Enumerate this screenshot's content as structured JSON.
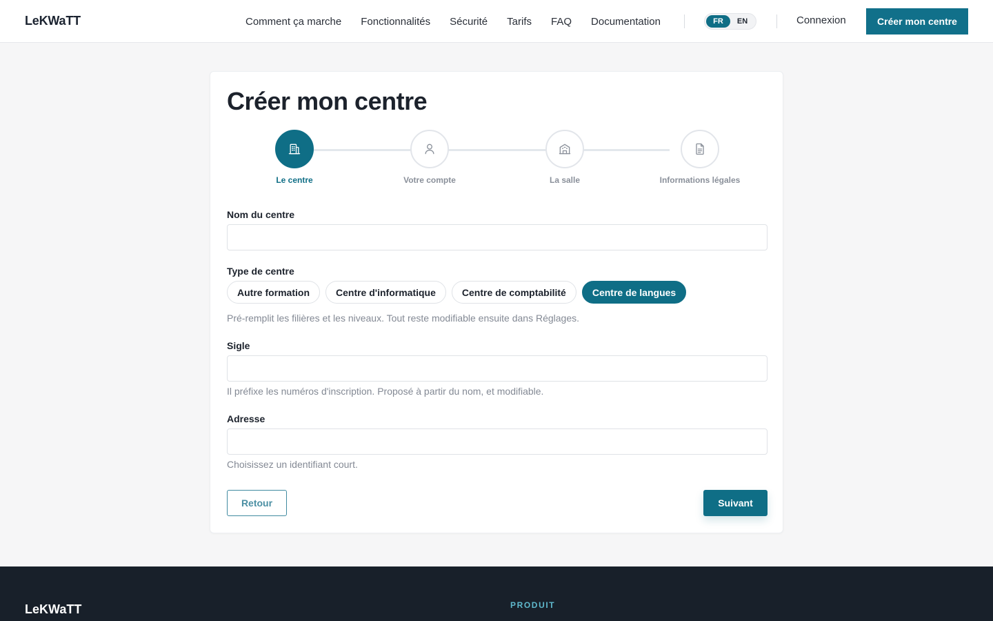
{
  "header": {
    "logo": "LeKWaTT",
    "nav": [
      "Comment ça marche",
      "Fonctionnalités",
      "Sécurité",
      "Tarifs",
      "FAQ",
      "Documentation"
    ],
    "lang": {
      "fr": "FR",
      "en": "EN",
      "selected": "FR"
    },
    "login": "Connexion",
    "cta": "Créer mon centre"
  },
  "page": {
    "title": "Créer mon centre",
    "steps": [
      {
        "label": "Le centre",
        "icon": "building-icon",
        "active": true
      },
      {
        "label": "Votre compte",
        "icon": "user-icon",
        "active": false
      },
      {
        "label": "La salle",
        "icon": "school-icon",
        "active": false
      },
      {
        "label": "Informations légales",
        "icon": "document-icon",
        "active": false
      }
    ],
    "form": {
      "name": {
        "label": "Nom du centre",
        "value": ""
      },
      "type": {
        "label": "Type de centre",
        "options": [
          "Autre formation",
          "Centre d'informatique",
          "Centre de comptabilité",
          "Centre de langues"
        ],
        "selected": "Centre de langues",
        "hint": "Pré-remplit les filières et les niveaux. Tout reste modifiable ensuite dans Réglages."
      },
      "sigle": {
        "label": "Sigle",
        "value": "",
        "hint": "Il préfixe les numéros d'inscription. Proposé à partir du nom, et modifiable."
      },
      "adresse": {
        "label": "Adresse",
        "value": "",
        "hint": "Choisissez un identifiant court."
      }
    },
    "buttons": {
      "back": "Retour",
      "next": "Suivant"
    }
  },
  "footer": {
    "logo": "LeKWaTT",
    "section": "PRODUIT"
  },
  "colors": {
    "accent": "#0f6e86",
    "footer_bg": "#18202a"
  }
}
